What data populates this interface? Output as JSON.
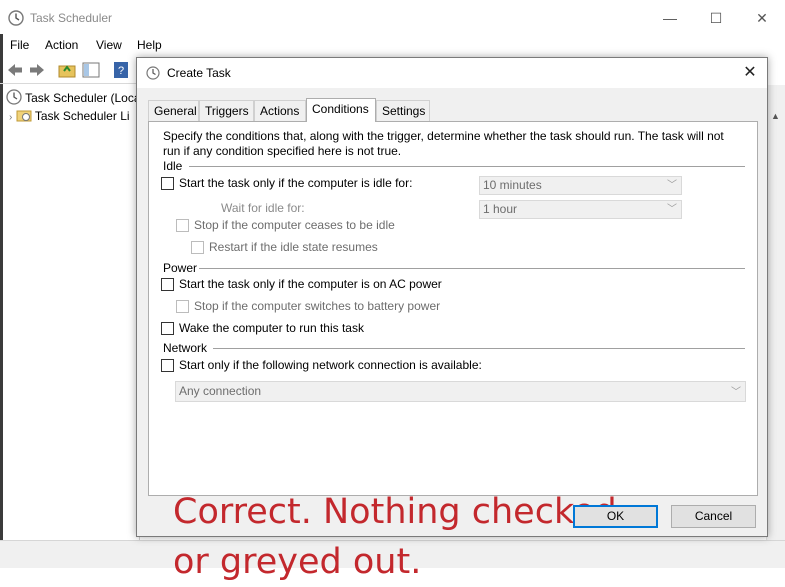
{
  "main_window": {
    "title": "Task Scheduler",
    "controls": {
      "minimize": "—",
      "maximize": "☐",
      "close": "✕"
    },
    "menu": [
      "File",
      "Action",
      "View",
      "Help"
    ],
    "tree": {
      "root": "Task Scheduler (Loca",
      "child": "Task Scheduler Li"
    }
  },
  "dialog": {
    "title": "Create Task",
    "close": "✕",
    "tabs": [
      "General",
      "Triggers",
      "Actions",
      "Conditions",
      "Settings"
    ],
    "active_tab": "Conditions",
    "description": "Specify the conditions that, along with the trigger, determine whether the task should run.  The task will not run  if any condition specified here is not true.",
    "idle": {
      "heading": "Idle",
      "start_if_idle": "Start the task only if the computer is idle for:",
      "idle_duration": "10 minutes",
      "wait_label": "Wait for idle for:",
      "wait_duration": "1 hour",
      "stop_if_ceases": "Stop if the computer ceases to be idle",
      "restart_if_resumes": "Restart if the idle state resumes"
    },
    "power": {
      "heading": "Power",
      "start_on_ac": "Start the task only if the computer is on AC power",
      "stop_on_battery": "Stop if the computer switches to battery power",
      "wake_to_run": "Wake the computer to run this task"
    },
    "network": {
      "heading": "Network",
      "start_if_network": "Start only if the following network connection is available:",
      "connection": "Any connection"
    },
    "annotation_line1": "Correct. Nothing checked",
    "annotation_line2": "or greyed out.",
    "ok": "OK",
    "cancel": "Cancel"
  },
  "colors": {
    "annotation": "#c3282d",
    "accent": "#0078d7"
  }
}
